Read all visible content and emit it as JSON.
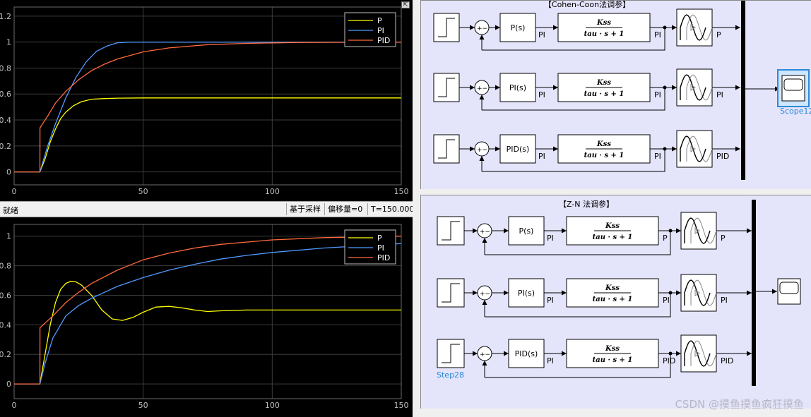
{
  "status_bar": {
    "state": "就绪",
    "sample_mode": "基于采样",
    "offset": "偏移量=0",
    "time": "T=150.000"
  },
  "scopes": [
    {
      "legend": [
        "P",
        "PI",
        "PID"
      ],
      "colors": [
        "#ffff00",
        "#4f9bff",
        "#ff6a3c"
      ]
    },
    {
      "legend": [
        "P",
        "PI",
        "PID"
      ],
      "colors": [
        "#ffff00",
        "#4f9bff",
        "#ff6a3c"
      ]
    }
  ],
  "chart_data": [
    {
      "type": "line",
      "x_ticks": [
        0,
        50,
        100,
        150
      ],
      "y_ticks": [
        "0",
        "0.2",
        "0.4",
        "0.6",
        "0.8",
        "1",
        "1.2"
      ],
      "xlim": [
        0,
        150
      ],
      "ylim": [
        -0.1,
        1.27
      ],
      "grid": true,
      "legend_position": "top-right",
      "step_time": 10,
      "series": [
        {
          "name": "P",
          "x": [
            0,
            10,
            12,
            14,
            16,
            18,
            20,
            23,
            26,
            30,
            35,
            40,
            50,
            70,
            100,
            150
          ],
          "y": [
            0,
            0,
            0.1,
            0.23,
            0.33,
            0.41,
            0.46,
            0.51,
            0.54,
            0.56,
            0.565,
            0.568,
            0.57,
            0.57,
            0.57,
            0.57
          ]
        },
        {
          "name": "PI",
          "x": [
            0,
            10,
            13,
            16,
            20,
            24,
            28,
            32,
            36,
            40,
            45,
            55,
            70,
            100,
            150
          ],
          "y": [
            0,
            0,
            0.2,
            0.37,
            0.57,
            0.73,
            0.85,
            0.93,
            0.97,
            0.995,
            1.0,
            1.0,
            1.0,
            1.0,
            1.0
          ]
        },
        {
          "name": "PID",
          "x": [
            0,
            10,
            10.01,
            13,
            16,
            20,
            25,
            30,
            35,
            40,
            50,
            60,
            75,
            90,
            110,
            150
          ],
          "y": [
            0,
            0,
            0.34,
            0.43,
            0.53,
            0.62,
            0.71,
            0.78,
            0.83,
            0.87,
            0.925,
            0.955,
            0.98,
            0.99,
            0.997,
            1.0
          ]
        }
      ]
    },
    {
      "type": "line",
      "x_ticks": [
        0,
        50,
        100,
        150
      ],
      "y_ticks": [
        "0",
        "0.2",
        "0.4",
        "0.6",
        "0.8",
        "1"
      ],
      "xlim": [
        0,
        150
      ],
      "ylim": [
        -0.1,
        1.08
      ],
      "grid": true,
      "legend_position": "top-right",
      "step_time": 10,
      "series": [
        {
          "name": "P",
          "x": [
            0,
            10,
            12,
            14,
            16,
            18,
            20,
            22,
            24,
            26,
            30,
            34,
            38,
            42,
            46,
            50,
            55,
            60,
            65,
            70,
            75,
            80,
            90,
            100,
            110,
            120,
            150
          ],
          "y": [
            0,
            0,
            0.2,
            0.4,
            0.55,
            0.64,
            0.68,
            0.695,
            0.69,
            0.67,
            0.6,
            0.5,
            0.44,
            0.43,
            0.45,
            0.485,
            0.52,
            0.525,
            0.515,
            0.5,
            0.49,
            0.495,
            0.5,
            0.5,
            0.5,
            0.5,
            0.5
          ]
        },
        {
          "name": "PI",
          "x": [
            0,
            10,
            12,
            15,
            20,
            25,
            30,
            40,
            50,
            60,
            70,
            80,
            90,
            100,
            120,
            150
          ],
          "y": [
            0,
            0,
            0.14,
            0.31,
            0.46,
            0.53,
            0.58,
            0.66,
            0.72,
            0.77,
            0.81,
            0.845,
            0.87,
            0.89,
            0.92,
            0.95
          ]
        },
        {
          "name": "PID",
          "x": [
            0,
            10,
            10.01,
            15,
            20,
            25,
            30,
            40,
            50,
            60,
            70,
            80,
            90,
            100,
            120,
            150
          ],
          "y": [
            0,
            0,
            0.38,
            0.46,
            0.55,
            0.62,
            0.68,
            0.77,
            0.84,
            0.885,
            0.92,
            0.945,
            0.96,
            0.975,
            0.99,
            1.0
          ]
        }
      ]
    }
  ],
  "model_top": {
    "title": "【Cohen-Coon法调参】",
    "scope_label": "Scope12",
    "rows": [
      {
        "controller": "P(s)",
        "label_a": "PI",
        "label_b": "PI",
        "out": "P"
      },
      {
        "controller": "PI(s)",
        "label_a": "PI",
        "label_b": "PI",
        "out": "PI"
      },
      {
        "controller": "PID(s)",
        "label_a": "PI",
        "label_b": "PI",
        "out": "PID"
      }
    ],
    "plant_num": "Kss",
    "plant_den": "tau · s + 1"
  },
  "model_bottom": {
    "title": "【Z-N 法调参】",
    "step_label": "Step28",
    "rows": [
      {
        "controller": "P(s)",
        "label_a": "PI",
        "label_b": "P",
        "label_b2": "PI",
        "out": "P"
      },
      {
        "controller": "PI(s)",
        "label_a": "PI",
        "label_b": "PI",
        "label_b2": "PI",
        "out": "PI"
      },
      {
        "controller": "PID(s)",
        "label_a": "PI",
        "label_b": "PID",
        "label_b2": "PI",
        "out": "PID"
      }
    ],
    "plant_num": "Kss",
    "plant_den": "tau · s + 1"
  },
  "sum_sign": "+−",
  "watermark": "CSDN @摸鱼摸鱼疯狂摸鱼"
}
